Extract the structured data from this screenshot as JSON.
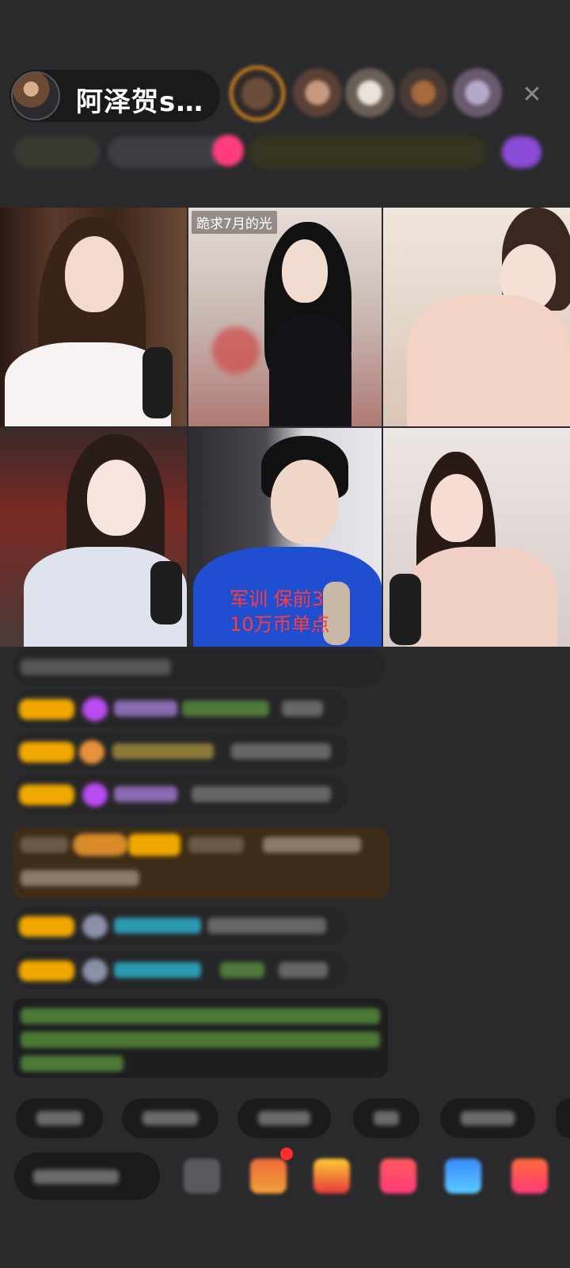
{
  "header": {
    "host_name": "阿泽贺s…",
    "close_icon": "close-icon",
    "viewers": [
      "viewer-avatar",
      "viewer-avatar",
      "viewer-avatar",
      "viewer-avatar",
      "viewer-avatar"
    ]
  },
  "video_grid": {
    "tiles": [
      {
        "id": "tile-1",
        "title": ""
      },
      {
        "id": "tile-2",
        "title": "跪求7月的光"
      },
      {
        "id": "tile-3",
        "title": ""
      },
      {
        "id": "tile-4",
        "title": ""
      },
      {
        "id": "tile-5",
        "title": "",
        "caption_line1": "军训 保前3",
        "caption_line2": "10万币单点"
      },
      {
        "id": "tile-6",
        "title": ""
      }
    ]
  },
  "colors": {
    "background": "#2a2a2c",
    "badge": "#f0a800",
    "gem": "#b84cf0",
    "promo_card": "#3c2c18",
    "caption_red": "#ff3b3b",
    "notice_text": "#7ed957"
  }
}
